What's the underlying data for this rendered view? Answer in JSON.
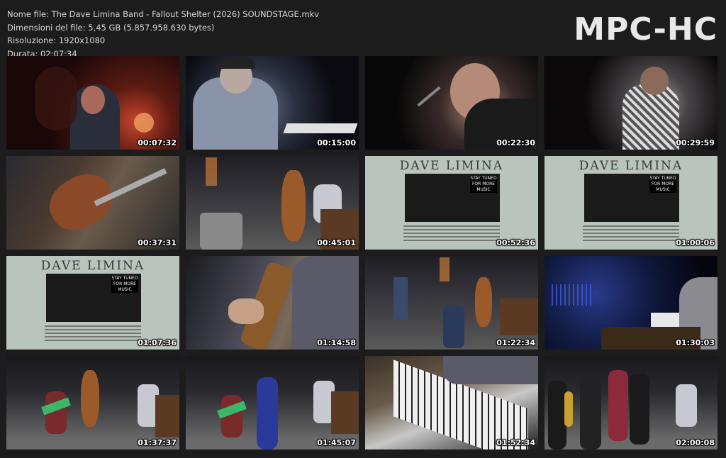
{
  "file_info": {
    "name_line": "Nome file: The Dave Limina Band - Fallout Shelter (2026) SOUNDSTAGE.mkv",
    "size_line": "Dimensioni del file: 5,45 GB (5.857.958.630 bytes)",
    "resolution_line": "Risoluzione: 1920x1080",
    "duration_line": "Durata: 02:07:34"
  },
  "logo": "MPC-HC",
  "poster": {
    "title": "DAVE LIMINA",
    "tag": "STAY TUNED FOR MORE MUSIC"
  },
  "thumbnails": [
    {
      "timestamp": "00:07:32"
    },
    {
      "timestamp": "00:15:00"
    },
    {
      "timestamp": "00:22:30"
    },
    {
      "timestamp": "00:29:59"
    },
    {
      "timestamp": "00:37:31"
    },
    {
      "timestamp": "00:45:01"
    },
    {
      "timestamp": "00:52:36"
    },
    {
      "timestamp": "01:00:06"
    },
    {
      "timestamp": "01:07:36"
    },
    {
      "timestamp": "01:14:58"
    },
    {
      "timestamp": "01:22:34"
    },
    {
      "timestamp": "01:30:03"
    },
    {
      "timestamp": "01:37:37"
    },
    {
      "timestamp": "01:45:07"
    },
    {
      "timestamp": "01:52:34"
    },
    {
      "timestamp": "02:00:08"
    }
  ]
}
